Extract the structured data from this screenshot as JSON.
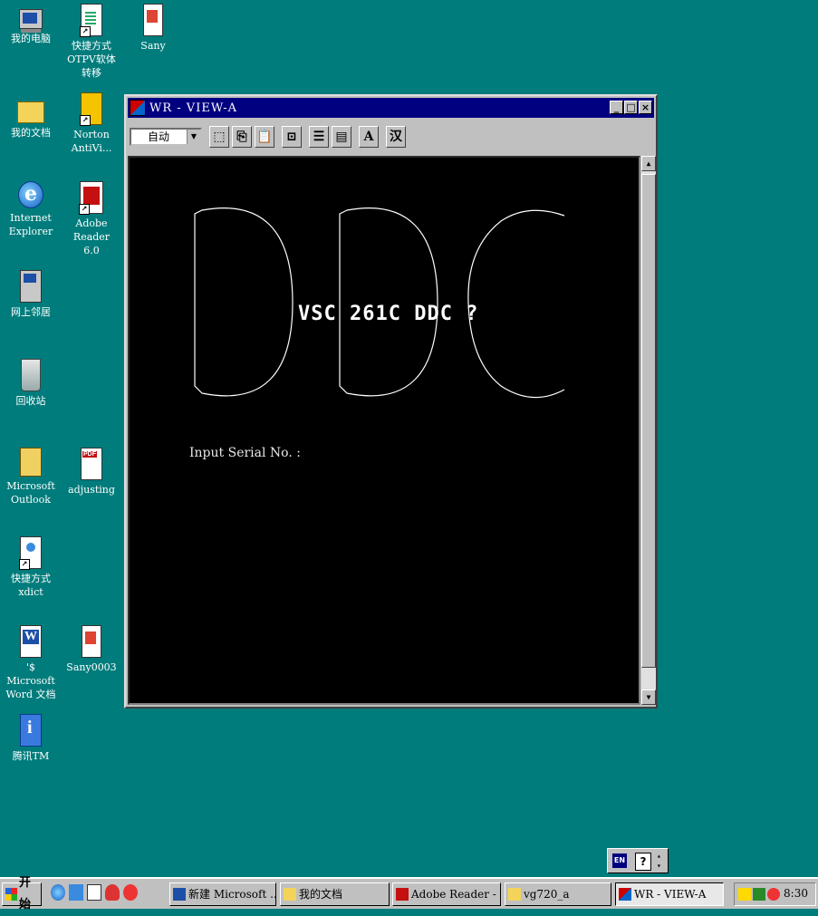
{
  "desktop": {
    "icons": [
      {
        "label": "我的电脑"
      },
      {
        "label": "快捷方式\nOTPV软体转移"
      },
      {
        "label": "Sany"
      },
      {
        "label": "我的文档"
      },
      {
        "label": "Norton\nAntiVi..."
      },
      {
        "label": "Internet\nExplorer"
      },
      {
        "label": "Adobe Reader\n6.0"
      },
      {
        "label": "网上邻居"
      },
      {
        "label": "回收站"
      },
      {
        "label": "Microsoft\nOutlook"
      },
      {
        "label": "adjusting"
      },
      {
        "label": "快捷方式\nxdict"
      },
      {
        "label": "'$ Microsoft\nWord 文档"
      },
      {
        "label": "Sany0003"
      },
      {
        "label": "腾讯TM"
      }
    ]
  },
  "window": {
    "title": "WR - VIEW-A",
    "toolbar": {
      "combo_value": "自动",
      "font_button": "A",
      "chinese_button": "汉"
    },
    "terminal": {
      "banner": "VSC 261C DDC ?",
      "prompt": "Input Serial No. :"
    }
  },
  "langbar": {
    "lang": "EN",
    "help": "?"
  },
  "taskbar": {
    "start_label": "开始",
    "tasks": [
      {
        "label": "新建 Microsoft ..."
      },
      {
        "label": "我的文档"
      },
      {
        "label": "Adobe Reader - ..."
      },
      {
        "label": "vg720_a"
      },
      {
        "label": "WR - VIEW-A"
      }
    ],
    "clock": "8:30"
  }
}
